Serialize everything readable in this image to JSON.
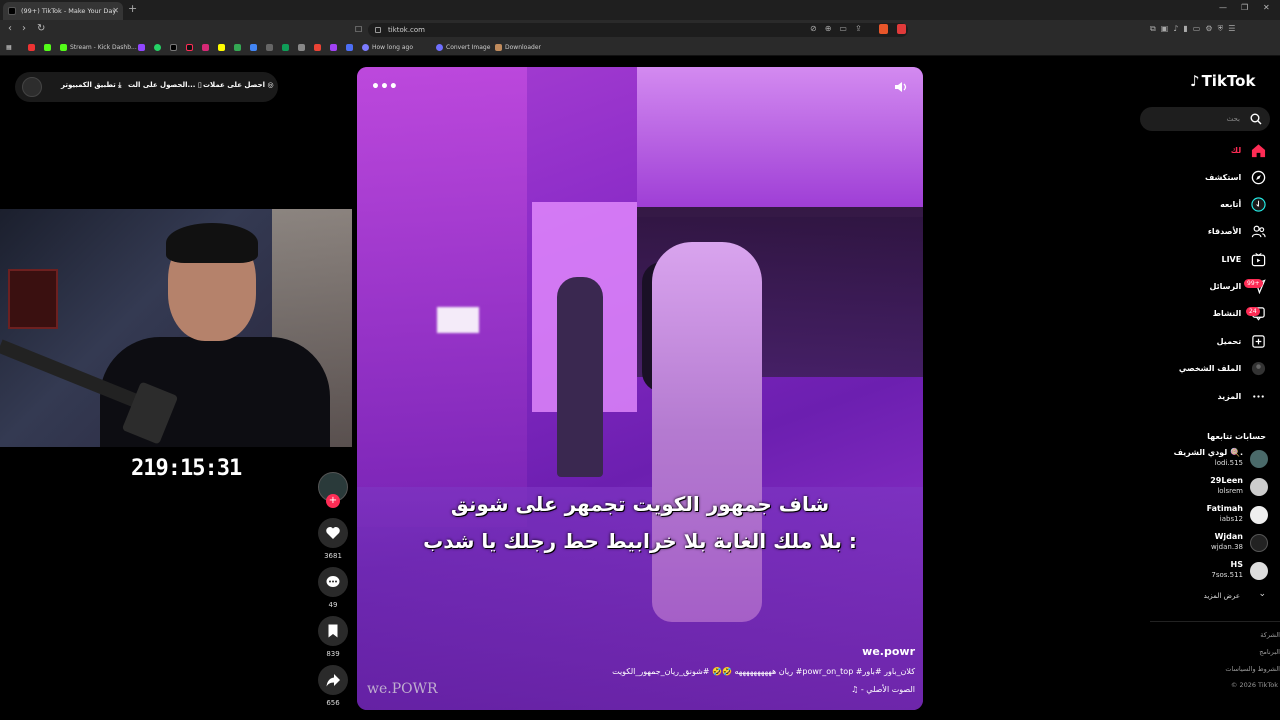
{
  "browser": {
    "tab_title": "(99+) TikTok - Make Your Day",
    "url": "tiktok.com",
    "bookmarks": [
      "Stream - Kick Dashb...",
      "How long ago",
      "Convert Image",
      "Downloader"
    ]
  },
  "promo": {
    "get_coins": "احصل على عملات",
    "get_app": "الحصول على الت...",
    "pc_app": "تطبيق الكمبيوتر"
  },
  "stream": {
    "timer": "219:15:31"
  },
  "video": {
    "caption_line1": "شاف جمهور الكويت تجمهر على شونق",
    "caption_line2": "بلا ملك الغابة بلا خرابيط حط رجلك يا شدب :",
    "handle": "we.powr",
    "description": "ريان ههههههههههه 🤣🤣 #شونق_ريان_جمهور_الكويت #powr_on_top #كلان_باور #باور",
    "music": "♫ - الصوت الأصلي",
    "watermark": "we.POWR"
  },
  "actions": {
    "likes": "3681",
    "comments": "49",
    "saves": "839",
    "shares": "656"
  },
  "sidebar": {
    "brand": "TikTok",
    "search_placeholder": "بحث",
    "nav": {
      "foryou": "لك",
      "explore": "استكشف",
      "following": "أتابعه",
      "friends": "الأصدقاء",
      "live": "LIVE",
      "messages": "الرسائل",
      "messages_badge": "99+",
      "activity": "النشاط",
      "activity_badge": "24",
      "upload": "تحميل",
      "profile": "الملف الشخصي",
      "more": "المزيد"
    },
    "following_title": "حسابات تتابعها",
    "accounts": [
      {
        "name": "لودي الشريف 🍭.",
        "handle": "lodi.515"
      },
      {
        "name": "29Leen",
        "handle": "lolsrem"
      },
      {
        "name": "Fatimah",
        "handle": "iabs12"
      },
      {
        "name": "Wjdan",
        "handle": "wjdan.38"
      },
      {
        "name": "HS",
        "handle": "7sos.511"
      }
    ],
    "see_more": "عرض المزيد",
    "footer": {
      "company": "الشركة",
      "program": "البرنامج",
      "terms": "الشروط والسياسات",
      "copyright": "© 2026 TikTok"
    }
  },
  "colors": {
    "accent": "#fe2c55",
    "video_purple": "#8a2bc7",
    "background": "#000000"
  }
}
